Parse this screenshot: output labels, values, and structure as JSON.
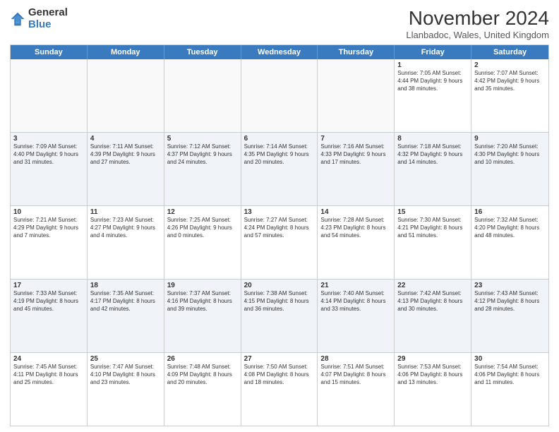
{
  "header": {
    "logo_general": "General",
    "logo_blue": "Blue",
    "month_title": "November 2024",
    "location": "Llanbadoc, Wales, United Kingdom"
  },
  "days_of_week": [
    "Sunday",
    "Monday",
    "Tuesday",
    "Wednesday",
    "Thursday",
    "Friday",
    "Saturday"
  ],
  "weeks": [
    [
      {
        "day": "",
        "info": ""
      },
      {
        "day": "",
        "info": ""
      },
      {
        "day": "",
        "info": ""
      },
      {
        "day": "",
        "info": ""
      },
      {
        "day": "",
        "info": ""
      },
      {
        "day": "1",
        "info": "Sunrise: 7:05 AM\nSunset: 4:44 PM\nDaylight: 9 hours and 38 minutes."
      },
      {
        "day": "2",
        "info": "Sunrise: 7:07 AM\nSunset: 4:42 PM\nDaylight: 9 hours and 35 minutes."
      }
    ],
    [
      {
        "day": "3",
        "info": "Sunrise: 7:09 AM\nSunset: 4:40 PM\nDaylight: 9 hours and 31 minutes."
      },
      {
        "day": "4",
        "info": "Sunrise: 7:11 AM\nSunset: 4:39 PM\nDaylight: 9 hours and 27 minutes."
      },
      {
        "day": "5",
        "info": "Sunrise: 7:12 AM\nSunset: 4:37 PM\nDaylight: 9 hours and 24 minutes."
      },
      {
        "day": "6",
        "info": "Sunrise: 7:14 AM\nSunset: 4:35 PM\nDaylight: 9 hours and 20 minutes."
      },
      {
        "day": "7",
        "info": "Sunrise: 7:16 AM\nSunset: 4:33 PM\nDaylight: 9 hours and 17 minutes."
      },
      {
        "day": "8",
        "info": "Sunrise: 7:18 AM\nSunset: 4:32 PM\nDaylight: 9 hours and 14 minutes."
      },
      {
        "day": "9",
        "info": "Sunrise: 7:20 AM\nSunset: 4:30 PM\nDaylight: 9 hours and 10 minutes."
      }
    ],
    [
      {
        "day": "10",
        "info": "Sunrise: 7:21 AM\nSunset: 4:29 PM\nDaylight: 9 hours and 7 minutes."
      },
      {
        "day": "11",
        "info": "Sunrise: 7:23 AM\nSunset: 4:27 PM\nDaylight: 9 hours and 4 minutes."
      },
      {
        "day": "12",
        "info": "Sunrise: 7:25 AM\nSunset: 4:26 PM\nDaylight: 9 hours and 0 minutes."
      },
      {
        "day": "13",
        "info": "Sunrise: 7:27 AM\nSunset: 4:24 PM\nDaylight: 8 hours and 57 minutes."
      },
      {
        "day": "14",
        "info": "Sunrise: 7:28 AM\nSunset: 4:23 PM\nDaylight: 8 hours and 54 minutes."
      },
      {
        "day": "15",
        "info": "Sunrise: 7:30 AM\nSunset: 4:21 PM\nDaylight: 8 hours and 51 minutes."
      },
      {
        "day": "16",
        "info": "Sunrise: 7:32 AM\nSunset: 4:20 PM\nDaylight: 8 hours and 48 minutes."
      }
    ],
    [
      {
        "day": "17",
        "info": "Sunrise: 7:33 AM\nSunset: 4:19 PM\nDaylight: 8 hours and 45 minutes."
      },
      {
        "day": "18",
        "info": "Sunrise: 7:35 AM\nSunset: 4:17 PM\nDaylight: 8 hours and 42 minutes."
      },
      {
        "day": "19",
        "info": "Sunrise: 7:37 AM\nSunset: 4:16 PM\nDaylight: 8 hours and 39 minutes."
      },
      {
        "day": "20",
        "info": "Sunrise: 7:38 AM\nSunset: 4:15 PM\nDaylight: 8 hours and 36 minutes."
      },
      {
        "day": "21",
        "info": "Sunrise: 7:40 AM\nSunset: 4:14 PM\nDaylight: 8 hours and 33 minutes."
      },
      {
        "day": "22",
        "info": "Sunrise: 7:42 AM\nSunset: 4:13 PM\nDaylight: 8 hours and 30 minutes."
      },
      {
        "day": "23",
        "info": "Sunrise: 7:43 AM\nSunset: 4:12 PM\nDaylight: 8 hours and 28 minutes."
      }
    ],
    [
      {
        "day": "24",
        "info": "Sunrise: 7:45 AM\nSunset: 4:11 PM\nDaylight: 8 hours and 25 minutes."
      },
      {
        "day": "25",
        "info": "Sunrise: 7:47 AM\nSunset: 4:10 PM\nDaylight: 8 hours and 23 minutes."
      },
      {
        "day": "26",
        "info": "Sunrise: 7:48 AM\nSunset: 4:09 PM\nDaylight: 8 hours and 20 minutes."
      },
      {
        "day": "27",
        "info": "Sunrise: 7:50 AM\nSunset: 4:08 PM\nDaylight: 8 hours and 18 minutes."
      },
      {
        "day": "28",
        "info": "Sunrise: 7:51 AM\nSunset: 4:07 PM\nDaylight: 8 hours and 15 minutes."
      },
      {
        "day": "29",
        "info": "Sunrise: 7:53 AM\nSunset: 4:06 PM\nDaylight: 8 hours and 13 minutes."
      },
      {
        "day": "30",
        "info": "Sunrise: 7:54 AM\nSunset: 4:06 PM\nDaylight: 8 hours and 11 minutes."
      }
    ]
  ]
}
